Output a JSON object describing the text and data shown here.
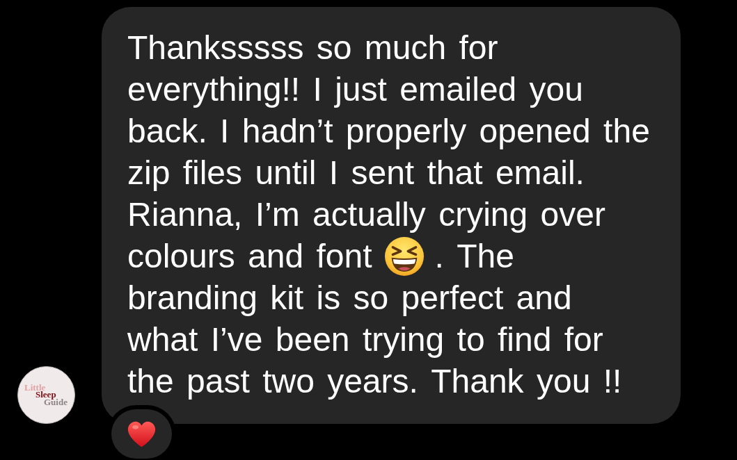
{
  "message": {
    "segments": [
      {
        "kind": "text",
        "text": "Thanksssss so much for everything!! I just emailed you back. I hadn’t properly opened the zip files until I sent that email. Rianna, I’m actually crying over colours and font"
      },
      {
        "kind": "emoji"
      },
      {
        "kind": "text",
        "text": ". The branding kit is so perfect and what I’ve been trying to find for the past two years. Thank you !!"
      }
    ]
  },
  "avatar": {
    "logo_lines": [
      "Little",
      "Sleep",
      "Guide"
    ]
  }
}
